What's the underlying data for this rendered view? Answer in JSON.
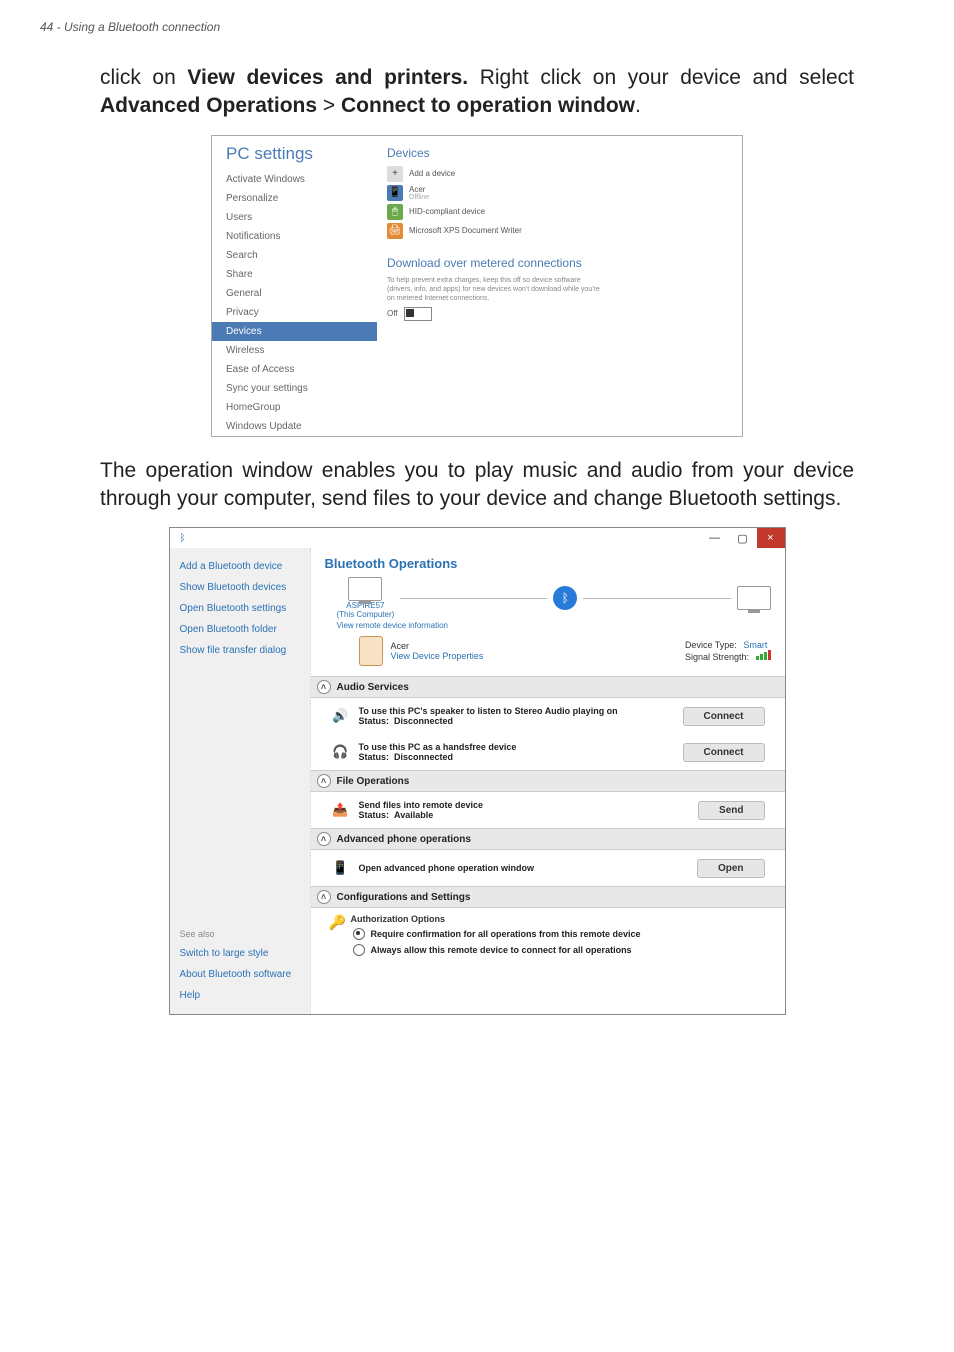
{
  "header": "44 - Using a Bluetooth connection",
  "intro": {
    "p1_a": "click on ",
    "p1_b": "View devices and printers.",
    "p1_c": " Right click on your device and select ",
    "p1_d": "Advanced Operations",
    "p1_e": " > ",
    "p1_f": "Connect to operation window",
    "p1_g": "."
  },
  "shot1": {
    "title": "PC settings",
    "nav": {
      "activate": "Activate Windows",
      "personalize": "Personalize",
      "users": "Users",
      "notifications": "Notifications",
      "search": "Search",
      "share": "Share",
      "general": "General",
      "privacy": "Privacy",
      "devices": "Devices",
      "wireless": "Wireless",
      "ease": "Ease of Access",
      "sync": "Sync your settings",
      "homegroup": "HomeGroup",
      "update": "Windows Update"
    },
    "right": {
      "devices_h": "Devices",
      "add": "Add a device",
      "dev1": "Acer",
      "dev1_sub": "Offline",
      "dev2": "HID-compliant device",
      "dev3": "Microsoft XPS Document Writer",
      "metered_h": "Download over metered connections",
      "metered_desc": "To help prevent extra charges, keep this off so device software (drivers, info, and apps) for new devices won't download while you're on metered Internet connections.",
      "toggle_label": "Off"
    }
  },
  "para2": "The operation window enables you to play music and audio from your device through your computer, send files to your device and change Bluetooth settings.",
  "shot2": {
    "window": {
      "min": "—",
      "max": "▢",
      "close": "×"
    },
    "left": {
      "add": "Add a Bluetooth device",
      "show": "Show Bluetooth devices",
      "settings": "Open Bluetooth settings",
      "folder": "Open Bluetooth folder",
      "transfer": "Show file transfer dialog",
      "seealso": "See also",
      "switch": "Switch to large style",
      "about": "About Bluetooth software",
      "help": "Help"
    },
    "main": {
      "title": "Bluetooth Operations",
      "host": "ASPIRE57",
      "host_sub": "(This Computer)",
      "view_remote": "View remote device information",
      "remote_name": "Acer",
      "view_props": "View Device Properties",
      "type_lbl": "Device Type:",
      "type_val": "Smart",
      "sig_lbl": "Signal Strength:",
      "groups": {
        "audio": "Audio Services",
        "file": "File Operations",
        "phone": "Advanced phone operations",
        "config": "Configurations and Settings"
      },
      "audio1_txt": "To use this PC's speaker to listen to Stereo Audio playing on",
      "status_lbl": "Status:",
      "disconnected": "Disconnected",
      "available": "Available",
      "audio2_txt": "To use this PC as a handsfree device",
      "connect_btn": "Connect",
      "file_txt": "Send files into remote device",
      "send_btn": "Send",
      "phone_txt": "Open advanced phone operation window",
      "open_btn": "Open",
      "auth_title": "Authorization Options",
      "radio1": "Require confirmation for all operations from this remote device",
      "radio2": "Always allow this remote device to connect for all operations"
    }
  }
}
